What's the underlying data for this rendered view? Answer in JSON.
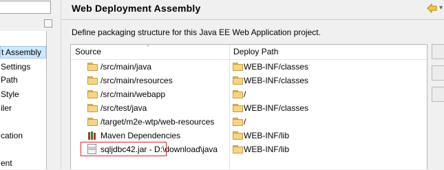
{
  "nav": {
    "items": [
      "t Assembly",
      "Settings",
      "Path",
      "Style",
      "iler",
      "cation",
      "ent"
    ]
  },
  "page": {
    "title": "Web Deployment Assembly",
    "description": "Define packaging structure for this Java EE Web Application project."
  },
  "table": {
    "headers": {
      "source": "Source",
      "deploy": "Deploy Path"
    },
    "rows": [
      {
        "source": "/src/main/java",
        "deploy": "WEB-INF/classes",
        "icon": "folder-icon"
      },
      {
        "source": "/src/main/resources",
        "deploy": "WEB-INF/classes",
        "icon": "folder-icon"
      },
      {
        "source": "/src/main/webapp",
        "deploy": "/",
        "icon": "folder-icon"
      },
      {
        "source": "/src/test/java",
        "deploy": "WEB-INF/classes",
        "icon": "folder-icon"
      },
      {
        "source": "/target/m2e-wtp/web-resources",
        "deploy": "/",
        "icon": "folder-icon"
      },
      {
        "source": "Maven Dependencies",
        "deploy": "WEB-INF/lib",
        "icon": "maven-library-icon"
      },
      {
        "source": "sqljdbc42.jar - D:\\download\\java",
        "deploy": "WEB-INF/lib",
        "icon": "jar-icon"
      }
    ]
  },
  "colors": {
    "highlight": "#e02020",
    "selection": "#cde8ff",
    "folder": "#f5d584"
  }
}
